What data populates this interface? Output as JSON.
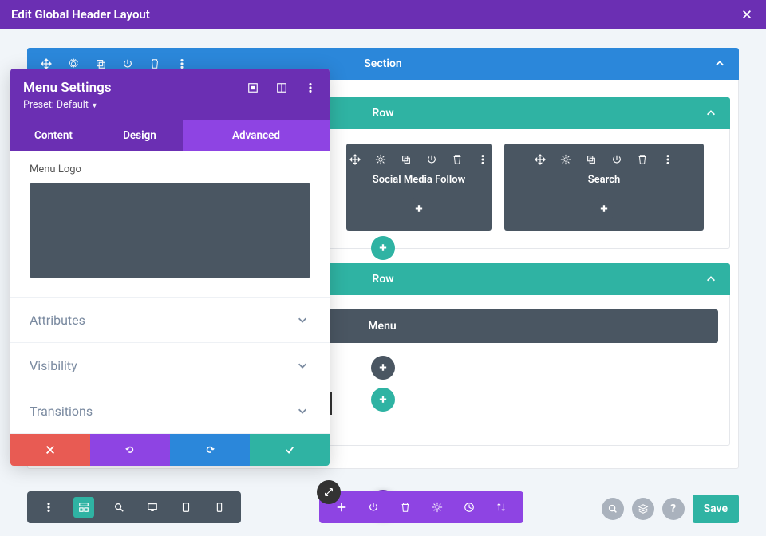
{
  "header": {
    "title": "Edit Global Header Layout"
  },
  "section": {
    "label": "Section",
    "rows": [
      {
        "label": "Row",
        "modules": [
          {
            "label": "Social Media Follow"
          },
          {
            "label": "Search"
          }
        ]
      },
      {
        "label": "Row",
        "modules": [
          {
            "label": "Menu"
          }
        ]
      }
    ]
  },
  "settings_panel": {
    "title": "Menu Settings",
    "preset": "Preset: Default",
    "tabs": {
      "content": "Content",
      "design": "Design",
      "advanced": "Advanced"
    },
    "logo_label": "Menu Logo",
    "accordion": {
      "attributes": "Attributes",
      "visibility": "Visibility",
      "transitions": "Transitions"
    }
  },
  "bottom_right": {
    "save": "Save"
  }
}
